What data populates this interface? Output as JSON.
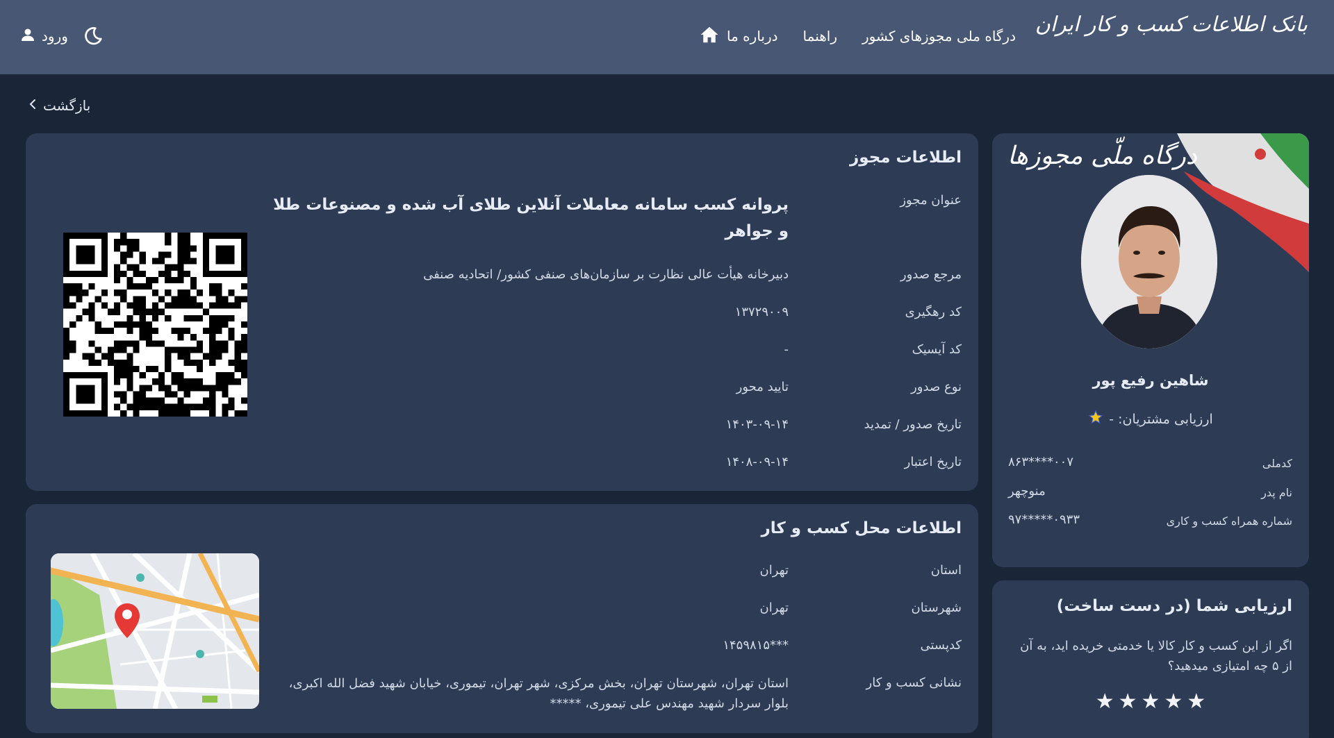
{
  "header": {
    "logo_text": "بانک اطلاعات کسب و کار ایران",
    "nav": {
      "about": "درباره ما",
      "guide": "راهنما",
      "portal": "درگاه ملی مجوزهای کشور"
    },
    "login_label": "ورود",
    "icons": {
      "home": "home-icon",
      "theme": "moon-icon",
      "user": "user-icon"
    }
  },
  "back_label": "بازگشت",
  "permit": {
    "title": "اطلاعات مجوز",
    "rows": {
      "title_label": "عنوان مجوز",
      "title_value": "پروانه کسب سامانه معاملات آنلاین طلای آب شده و مصنوعات طلا و جواهر",
      "issuer_label": "مرجع صدور",
      "issuer_value": "دبیرخانه هیأت عالی نظارت بر سازمان‌های صنفی کشور/ اتحادیه صنفی",
      "tracking_label": "کد رهگیری",
      "tracking_value": "۱۳۷۲۹۰۰۹",
      "isic_label": "کد آیسیک",
      "isic_value": "-",
      "type_label": "نوع صدور",
      "type_value": "تایید محور",
      "issue_date_label": "تاریخ صدور / تمدید",
      "issue_date_value": "۱۴۰۳-۰۹-۱۴",
      "validity_label": "تاریخ اعتبار",
      "validity_value": "۱۴۰۸-۰۹-۱۴"
    }
  },
  "location": {
    "title": "اطلاعات محل کسب و کار",
    "rows": {
      "province_label": "استان",
      "province_value": "تهران",
      "city_label": "شهرستان",
      "city_value": "تهران",
      "postal_label": "کدپستی",
      "postal_value": "***۱۴۵۹۸۱۵",
      "address_label": "نشانی کسب و کار",
      "address_value": "استان تهران، شهرستان تهران، بخش مرکزی، شهر تهران، تیموری، خیابان شهید فضل الله اکبری، بلوار سردار شهید مهندس علی تیموری، *****"
    }
  },
  "profile": {
    "portal_logo": "درگاه ملّی مجوزها",
    "name": "شاهین رفیع پور",
    "rating_text": "ارزیابی مشتریان: -",
    "national_id_label": "کدملی",
    "national_id_value": "۰۰۷****۸۶۳",
    "father_label": "نام پدر",
    "father_value": "منوچهر",
    "mobile_label": "شماره همراه کسب و کاری",
    "mobile_value": "۰۹۳۳*****۹۷"
  },
  "rating": {
    "title": "ارزیابی شما (در دست ساخت)",
    "description": "اگر از این کسب و کار کالا یا خدمتی خریده اید، به آن از ۵ چه امتیازی میدهید؟",
    "stars": [
      "★",
      "★",
      "★",
      "★",
      "★"
    ]
  },
  "colors": {
    "header_bg": "#485774",
    "page_bg": "#1b2538",
    "card_bg": "#2d3b55",
    "accent_star": "#f5c518"
  }
}
